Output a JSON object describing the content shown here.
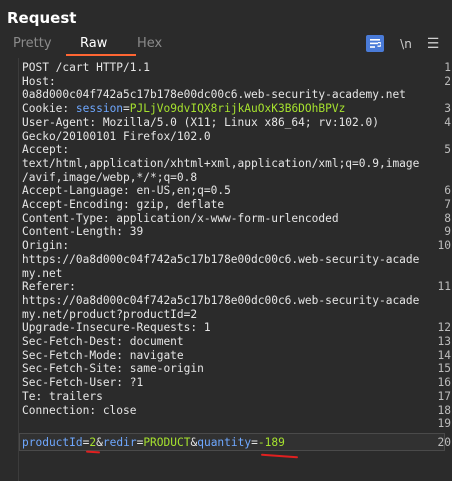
{
  "header": {
    "title": "Request"
  },
  "tabs": [
    {
      "label": "Pretty",
      "active": false
    },
    {
      "label": "Raw",
      "active": true
    },
    {
      "label": "Hex",
      "active": false
    }
  ],
  "toolbar": {
    "newline_label": "\\n",
    "menu_icon": "hamburger-menu-icon",
    "wrap_icon": "wrap-text-icon"
  },
  "colors": {
    "accent": "#ff6633",
    "param_name": "#6fa8ff",
    "param_value": "#a6e22e",
    "annotation": "#e02020"
  },
  "editor": {
    "lines": [
      {
        "n": "1",
        "t": "POST /cart HTTP/1.1"
      },
      {
        "n": "2",
        "t": "Host:"
      },
      {
        "n": "",
        "t": "0a8d000c04f742a5c17b178e00dc00c6.web-security-academy.net"
      },
      {
        "n": "3",
        "k": "Cookie: ",
        "cn": "session",
        "eq": "=",
        "cv": "PJLjVo9dvIQX8rijkAuOxK3B6DOhBPVz"
      },
      {
        "n": "4",
        "t": "User-Agent: Mozilla/5.0 (X11; Linux x86_64; rv:102.0)"
      },
      {
        "n": "",
        "t": "Gecko/20100101 Firefox/102.0"
      },
      {
        "n": "5",
        "t": "Accept:"
      },
      {
        "n": "",
        "t": "text/html,application/xhtml+xml,application/xml;q=0.9,image"
      },
      {
        "n": "",
        "t": "/avif,image/webp,*/*;q=0.8"
      },
      {
        "n": "6",
        "t": "Accept-Language: en-US,en;q=0.5"
      },
      {
        "n": "7",
        "t": "Accept-Encoding: gzip, deflate"
      },
      {
        "n": "8",
        "t": "Content-Type: application/x-www-form-urlencoded"
      },
      {
        "n": "9",
        "t": "Content-Length: 39"
      },
      {
        "n": "10",
        "t": "Origin:"
      },
      {
        "n": "",
        "t": "https://0a8d000c04f742a5c17b178e00dc00c6.web-security-acade"
      },
      {
        "n": "",
        "t": "my.net"
      },
      {
        "n": "11",
        "t": "Referer:"
      },
      {
        "n": "",
        "t": "https://0a8d000c04f742a5c17b178e00dc00c6.web-security-acade"
      },
      {
        "n": "",
        "t": "my.net/product?productId=2"
      },
      {
        "n": "12",
        "t": "Upgrade-Insecure-Requests: 1"
      },
      {
        "n": "13",
        "t": "Sec-Fetch-Dest: document"
      },
      {
        "n": "14",
        "t": "Sec-Fetch-Mode: navigate"
      },
      {
        "n": "15",
        "t": "Sec-Fetch-Site: same-origin"
      },
      {
        "n": "16",
        "t": "Sec-Fetch-User: ?1"
      },
      {
        "n": "17",
        "t": "Te: trailers"
      },
      {
        "n": "18",
        "t": "Connection: close"
      },
      {
        "n": "19",
        "t": ""
      }
    ],
    "body_line": {
      "n": "20",
      "p1": "productId",
      "e1": "=",
      "v1": "2",
      "a1": "&",
      "p2": "redir",
      "e2": "=",
      "v2": "PRODUCT",
      "a2": "&",
      "p3": "quantity",
      "e3": "=",
      "v3": "-189"
    }
  }
}
